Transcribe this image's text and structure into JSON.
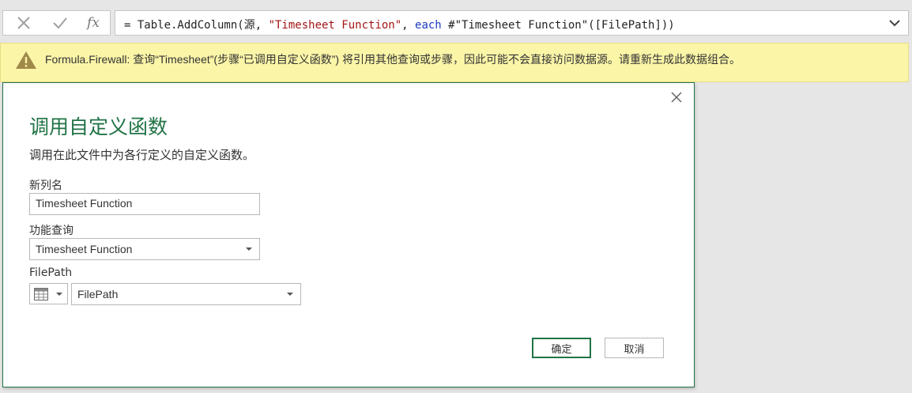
{
  "formula_bar": {
    "formula_prefix": "= Table.AddColumn(源, ",
    "formula_string": "\"Timesheet Function\"",
    "formula_sep": ", ",
    "formula_keyword": "each",
    "formula_suffix": " #\"Timesheet Function\"([FilePath]))"
  },
  "warning": {
    "text": "Formula.Firewall: 查询“Timesheet”(步骤“已调用自定义函数”) 将引用其他查询或步骤，因此可能不会直接访问数据源。请重新生成此数据组合。"
  },
  "dialog": {
    "title": "调用自定义函数",
    "description": "调用在此文件中为各行定义的自定义函数。",
    "new_column_label": "新列名",
    "new_column_value": "Timesheet Function",
    "function_query_label": "功能查询",
    "function_query_value": "Timesheet Function",
    "param_label": "FilePath",
    "param_value": "FilePath",
    "ok_label": "确定",
    "cancel_label": "取消"
  },
  "colors": {
    "accent": "#217346",
    "warning_bg": "#fbf5a8",
    "string_color": "#a31515",
    "keyword_color": "#1a3cc2"
  },
  "icons": [
    "close-icon",
    "check-icon",
    "fx-icon",
    "chevron-down-icon",
    "warning-icon",
    "table-icon"
  ]
}
